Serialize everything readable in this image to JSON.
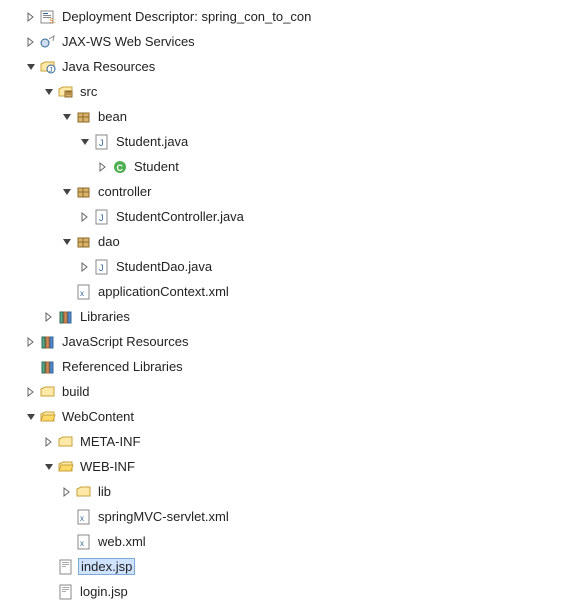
{
  "tree": {
    "deployment_descriptor": "Deployment Descriptor: spring_con_to_con",
    "jaxws": "JAX-WS Web Services",
    "java_resources": "Java Resources",
    "src": "src",
    "bean": "bean",
    "student_java": "Student.java",
    "student_class": "Student",
    "controller": "controller",
    "student_controller_java": "StudentController.java",
    "dao": "dao",
    "student_dao_java": "StudentDao.java",
    "application_context_xml": "applicationContext.xml",
    "libraries": "Libraries",
    "javascript_resources": "JavaScript Resources",
    "referenced_libraries": "Referenced Libraries",
    "build": "build",
    "webcontent": "WebContent",
    "meta_inf": "META-INF",
    "web_inf": "WEB-INF",
    "lib": "lib",
    "spring_mvc_servlet_xml": "springMVC-servlet.xml",
    "web_xml": "web.xml",
    "index_jsp": "index.jsp",
    "login_jsp": "login.jsp"
  }
}
